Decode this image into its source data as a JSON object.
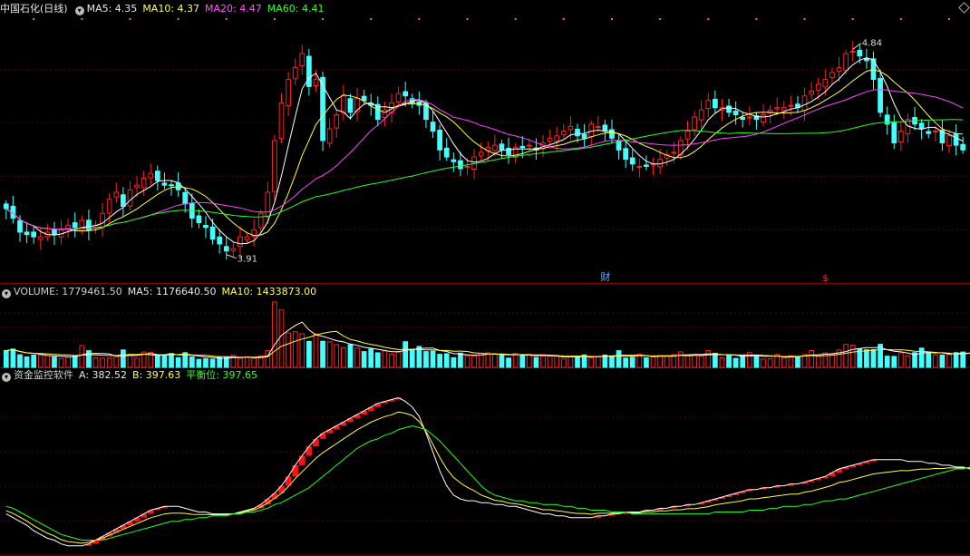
{
  "panels": {
    "price": {
      "title": "中国石化(日线)",
      "ma5": "MA5: 4.35",
      "ma10": "MA10: 4.37",
      "ma20": "MA20: 4.47",
      "ma60": "MA60: 4.41",
      "high_label": "4.84",
      "low_label": "3.91",
      "marker_cai": "财",
      "marker_s": "$"
    },
    "volume": {
      "label": "VOLUME: 1779461.50",
      "ma5": "MA5: 1176640.50",
      "ma10": "MA10: 1433873.00"
    },
    "indicator": {
      "name": "资金监控软件",
      "a": "A: 382.52",
      "b": "B: 397.63",
      "balance": "平衡位: 397.65"
    }
  },
  "colors": {
    "up": "#ff2020",
    "down": "#44ffff",
    "ma5": "#ffffff",
    "ma10": "#ffff44",
    "ma20": "#ff44ff",
    "ma60": "#22ff22",
    "grid": "#5a0000",
    "frame": "#8b0000"
  },
  "chart_data": [
    {
      "type": "candlestick",
      "title": "中国石化(日线)",
      "ylim": [
        3.85,
        4.9
      ],
      "series": [
        {
          "name": "K",
          "close": [
            4.12,
            4.08,
            4.02,
            4.01,
            4.0,
            4.0,
            4.02,
            4.01,
            4.03,
            4.05,
            4.04,
            4.07,
            4.03,
            4.05,
            4.1,
            4.16,
            4.19,
            4.13,
            4.2,
            4.22,
            4.25,
            4.27,
            4.24,
            4.22,
            4.22,
            4.2,
            4.14,
            4.08,
            4.06,
            4.04,
            3.99,
            3.97,
            3.94,
            3.95,
            4.0,
            4.0,
            4.03,
            4.1,
            4.19,
            4.41,
            4.57,
            4.67,
            4.72,
            4.78,
            4.64,
            4.67,
            4.41,
            4.46,
            4.52,
            4.6,
            4.53,
            4.59,
            4.58,
            4.56,
            4.5,
            4.54,
            4.57,
            4.61,
            4.6,
            4.57,
            4.56,
            4.5,
            4.45,
            4.37,
            4.34,
            4.32,
            4.29,
            4.3,
            4.34,
            4.36,
            4.38,
            4.39,
            4.37,
            4.35,
            4.38,
            4.38,
            4.39,
            4.37,
            4.4,
            4.42,
            4.43,
            4.45,
            4.47,
            4.43,
            4.42,
            4.48,
            4.47,
            4.45,
            4.42,
            4.37,
            4.33,
            4.31,
            4.3,
            4.3,
            4.31,
            4.33,
            4.35,
            4.36,
            4.41,
            4.45,
            4.51,
            4.54,
            4.58,
            4.55,
            4.55,
            4.53,
            4.52,
            4.5,
            4.51,
            4.5,
            4.52,
            4.54,
            4.55,
            4.55,
            4.56,
            4.55,
            4.6,
            4.62,
            4.65,
            4.67,
            4.7,
            4.72,
            4.78,
            4.79,
            4.77,
            4.75,
            4.67,
            4.53,
            4.48,
            4.4,
            4.45,
            4.5,
            4.48,
            4.46,
            4.44,
            4.45,
            4.4,
            4.43,
            4.39,
            4.37
          ]
        }
      ]
    },
    {
      "type": "bar",
      "title": "VOLUME",
      "series": [
        {
          "name": "VOLUME",
          "values": [
            1.11,
            1.21,
            0.83,
            0.69,
            0.81,
            0.8,
            0.78,
            0.68,
            0.58,
            0.67,
            0.76,
            1.44,
            1.1,
            0.64,
            0.6,
            0.61,
            0.72,
            1.15,
            0.84,
            0.6,
            1.01,
            1.0,
            0.75,
            0.81,
            0.91,
            0.64,
            0.97,
            0.69,
            0.53,
            0.57,
            0.54,
            0.66,
            0.66,
            0.79,
            0.6,
            0.68,
            0.6,
            0.76,
            1.1,
            4.31,
            3.79,
            2.27,
            2.35,
            2.22,
            1.71,
            2.2,
            1.72,
            1.68,
            1.5,
            1.3,
            1.49,
            1.27,
            1.04,
            1.21,
            0.96,
            1.08,
            0.88,
            1.01,
            1.69,
            1.2,
            1.38,
            1.04,
            1.07,
            0.86,
            0.9,
            0.64,
            0.94,
            0.77,
            0.76,
            0.93,
            0.96,
            0.92,
            0.82,
            0.61,
            0.92,
            0.79,
            0.86,
            0.65,
            0.74,
            0.75,
            0.73,
            0.56,
            0.69,
            0.72,
            0.82,
            0.64,
            0.68,
            0.81,
            0.76,
            1.1,
            0.61,
            0.67,
            0.87,
            0.63,
            0.74,
            0.73,
            0.74,
            0.84,
            1.02,
            0.79,
            0.84,
            0.72,
            1.1,
            0.93,
            0.63,
            0.77,
            0.59,
            0.76,
            0.97,
            0.81,
            0.54,
            0.56,
            0.86,
            0.64,
            0.76,
            0.72,
            0.84,
            1.11,
            0.73,
            0.95,
            0.85,
            1.15,
            1.52,
            1.46,
            1.21,
            1.16,
            1.17,
            1.52,
            0.74,
            0.72,
            0.96,
            0.76,
            0.97,
            1.27,
            0.94,
            0.82,
            0.81,
            0.84,
            0.97,
            1.01,
            1.02,
            1.78
          ]
        }
      ]
    },
    {
      "type": "line",
      "title": "资金监控软件",
      "ylim": [
        340,
        430
      ],
      "series": [
        {
          "name": "A",
          "values": [
            361,
            359,
            357,
            355,
            352,
            350,
            348,
            347,
            345,
            344,
            344,
            344,
            345,
            347,
            349,
            351,
            353,
            355,
            357,
            359,
            361,
            363,
            364,
            365,
            365,
            365,
            364,
            363,
            362,
            362,
            361,
            361,
            361,
            361,
            362,
            363,
            364,
            366,
            369,
            372,
            376,
            381,
            387,
            392,
            397,
            401,
            404,
            406,
            408,
            410,
            412,
            414,
            416,
            418,
            420,
            421,
            422,
            423,
            421,
            418,
            413,
            404,
            394,
            384,
            376,
            371,
            369,
            368,
            368,
            367,
            367,
            366,
            366,
            365,
            365,
            364,
            363,
            362,
            361,
            361,
            360,
            360,
            359,
            359,
            359,
            359,
            360,
            360,
            361,
            361,
            362,
            362,
            362,
            363,
            363,
            364,
            364,
            365,
            365,
            366,
            366,
            367,
            368,
            369,
            370,
            371,
            372,
            373,
            374,
            374,
            375,
            375,
            376,
            376,
            377,
            377,
            378,
            379,
            380,
            381,
            383,
            385,
            386,
            387,
            388,
            389,
            390,
            390,
            390,
            390,
            390,
            389,
            389,
            389,
            388,
            388,
            387,
            387,
            386,
            386,
            385,
            385
          ]
        },
        {
          "name": "B",
          "values": [
            365,
            364,
            362,
            360,
            358,
            356,
            354,
            352,
            350,
            349,
            348,
            347,
            347,
            347,
            347,
            348,
            349,
            350,
            351,
            352,
            353,
            354,
            355,
            356,
            357,
            357,
            358,
            358,
            359,
            359,
            360,
            360,
            360,
            361,
            361,
            362,
            362,
            363,
            364,
            366,
            367,
            369,
            371,
            373,
            375,
            378,
            381,
            384,
            387,
            390,
            393,
            396,
            398,
            400,
            401,
            403,
            404,
            406,
            407,
            408,
            407,
            406,
            403,
            400,
            396,
            392,
            388,
            384,
            380,
            376,
            373,
            371,
            370,
            369,
            368,
            368,
            367,
            367,
            366,
            366,
            366,
            365,
            365,
            364,
            364,
            363,
            363,
            363,
            362,
            362,
            362,
            361,
            361,
            361,
            361,
            361,
            361,
            361,
            361,
            361,
            361,
            361,
            361,
            362,
            362,
            362,
            362,
            362,
            363,
            363,
            363,
            364,
            364,
            365,
            365,
            365,
            366,
            366,
            367,
            368,
            368,
            369,
            369,
            370,
            371,
            372,
            373,
            374,
            375,
            376,
            377,
            378,
            379,
            380,
            381,
            382,
            383,
            384,
            385,
            385,
            386,
            386
          ]
        }
      ]
    }
  ]
}
